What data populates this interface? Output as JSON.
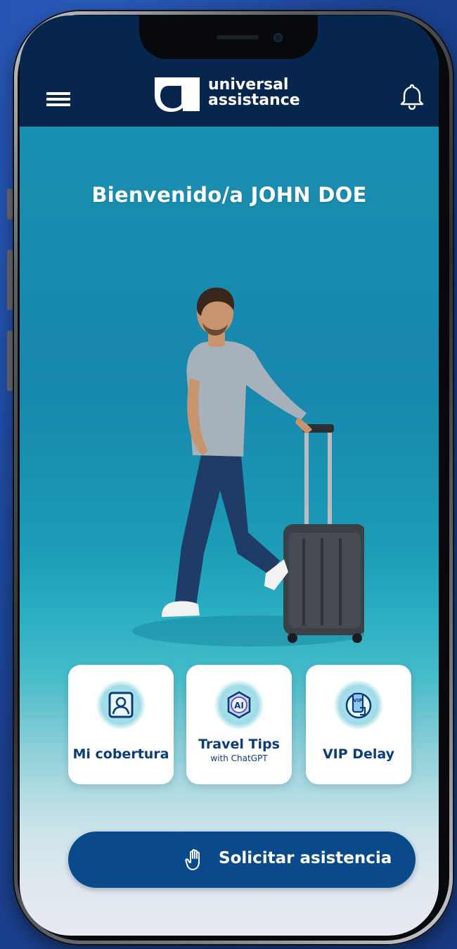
{
  "header": {
    "brand_line1": "universal",
    "brand_line2": "assistance"
  },
  "welcome": {
    "text": "Bienvenido/a JOHN DOE"
  },
  "cards": [
    {
      "label": "Mi cobertura",
      "sub": ""
    },
    {
      "label": "Travel Tips",
      "sub": "with ChatGPT"
    },
    {
      "label": "VIP Delay",
      "sub": ""
    }
  ],
  "cta": {
    "label": "Solicitar asistencia"
  },
  "colors": {
    "header_bg": "#07264d",
    "accent": "#0a4a8a",
    "card_text": "#0b3d7a",
    "icon_teal": "#9fdce7"
  },
  "icons": {
    "menu": "hamburger-menu-icon",
    "bell": "bell-icon",
    "coverage": "id-card-icon",
    "travel_tips": "ai-badge-icon",
    "vip_delay": "vip-phone-icon",
    "cta": "hand-icon"
  }
}
